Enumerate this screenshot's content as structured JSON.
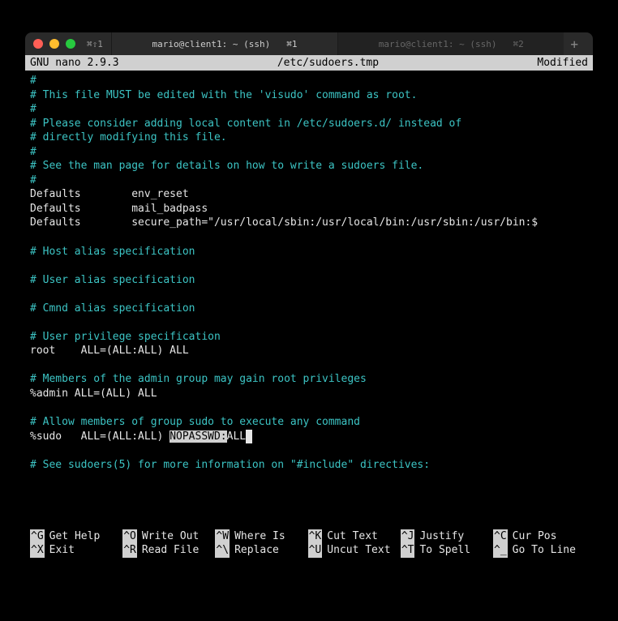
{
  "titlebar": {
    "left_shortcut": "⌘⇧1",
    "tabs": [
      {
        "title": "mario@client1: ~ (ssh)",
        "shortcut": "⌘1",
        "active": true
      },
      {
        "title": "mario@client1: ~ (ssh)",
        "shortcut": "⌘2",
        "active": false
      }
    ]
  },
  "statusbar": {
    "left": "GNU nano 2.9.3",
    "center": "/etc/sudoers.tmp",
    "right": "Modified"
  },
  "lines": [
    {
      "t": "#",
      "c": "cyan"
    },
    {
      "t": "# This file MUST be edited with the 'visudo' command as root.",
      "c": "cyan"
    },
    {
      "t": "#",
      "c": "cyan"
    },
    {
      "t": "# Please consider adding local content in /etc/sudoers.d/ instead of",
      "c": "cyan"
    },
    {
      "t": "# directly modifying this file.",
      "c": "cyan"
    },
    {
      "t": "#",
      "c": "cyan"
    },
    {
      "t": "# See the man page for details on how to write a sudoers file.",
      "c": "cyan"
    },
    {
      "t": "#",
      "c": "cyan"
    },
    {
      "t": "Defaults        env_reset",
      "c": "white"
    },
    {
      "t": "Defaults        mail_badpass",
      "c": "white"
    },
    {
      "t": "Defaults        secure_path=\"/usr/local/sbin:/usr/local/bin:/usr/sbin:/usr/bin:$",
      "c": "white"
    },
    {
      "t": " ",
      "c": "white"
    },
    {
      "t": "# Host alias specification",
      "c": "cyan"
    },
    {
      "t": " ",
      "c": "white"
    },
    {
      "t": "# User alias specification",
      "c": "cyan"
    },
    {
      "t": " ",
      "c": "white"
    },
    {
      "t": "# Cmnd alias specification",
      "c": "cyan"
    },
    {
      "t": " ",
      "c": "white"
    },
    {
      "t": "# User privilege specification",
      "c": "cyan"
    },
    {
      "t": "root    ALL=(ALL:ALL) ALL",
      "c": "white"
    },
    {
      "t": " ",
      "c": "white"
    },
    {
      "t": "# Members of the admin group may gain root privileges",
      "c": "cyan"
    },
    {
      "t": "%admin ALL=(ALL) ALL",
      "c": "white"
    },
    {
      "t": " ",
      "c": "white"
    },
    {
      "t": "# Allow members of group sudo to execute any command",
      "c": "cyan"
    }
  ],
  "edit_line": {
    "prefix": "%sudo   ALL=(ALL:ALL) ",
    "highlight": "NOPASSWD:",
    "suffix": "ALL"
  },
  "tail_lines": [
    {
      "t": " ",
      "c": "white"
    },
    {
      "t": "# See sudoers(5) for more information on \"#include\" directives:",
      "c": "cyan"
    }
  ],
  "shortcuts": {
    "row1": [
      {
        "key": "^G",
        "label": "Get Help"
      },
      {
        "key": "^O",
        "label": "Write Out"
      },
      {
        "key": "^W",
        "label": "Where Is"
      },
      {
        "key": "^K",
        "label": "Cut Text"
      },
      {
        "key": "^J",
        "label": "Justify"
      },
      {
        "key": "^C",
        "label": "Cur Pos"
      }
    ],
    "row2": [
      {
        "key": "^X",
        "label": "Exit"
      },
      {
        "key": "^R",
        "label": "Read File"
      },
      {
        "key": "^\\",
        "label": "Replace"
      },
      {
        "key": "^U",
        "label": "Uncut Text"
      },
      {
        "key": "^T",
        "label": "To Spell"
      },
      {
        "key": "^_",
        "label": "Go To Line"
      }
    ]
  }
}
